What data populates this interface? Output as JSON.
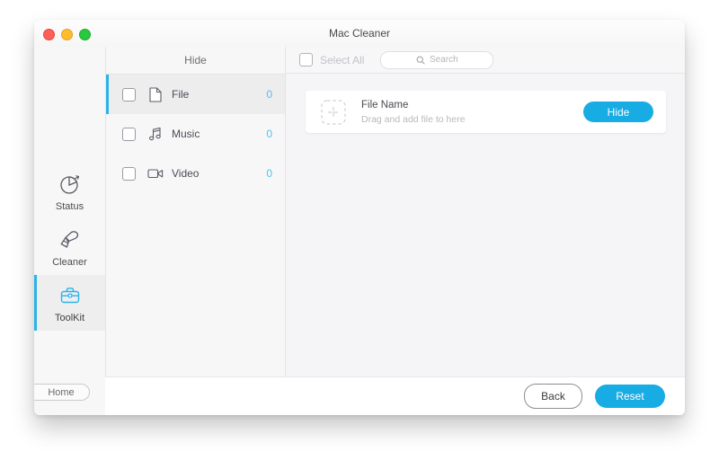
{
  "window": {
    "title": "Mac Cleaner",
    "traffic_lights": [
      {
        "name": "close",
        "color": "#ff5f57"
      },
      {
        "name": "minimize",
        "color": "#ffbd2e"
      },
      {
        "name": "zoom",
        "color": "#28c840"
      }
    ]
  },
  "rail": {
    "items": [
      {
        "label": "Status",
        "icon": "pie-chart-icon",
        "active": false
      },
      {
        "label": "Cleaner",
        "icon": "brush-icon",
        "active": false
      },
      {
        "label": "ToolKit",
        "icon": "toolbox-icon",
        "active": true
      }
    ],
    "home_label": "Home"
  },
  "categories": {
    "header": "Hide",
    "items": [
      {
        "label": "File",
        "count": "0",
        "icon": "file-icon",
        "checked": false,
        "selected": true
      },
      {
        "label": "Music",
        "count": "0",
        "icon": "music-note-icon",
        "checked": false,
        "selected": false
      },
      {
        "label": "Video",
        "count": "0",
        "icon": "video-camera-icon",
        "checked": false,
        "selected": false
      }
    ]
  },
  "toolbar": {
    "select_all_label": "Select All",
    "select_all_checked": false,
    "search_placeholder": "Search"
  },
  "drop_card": {
    "title": "File Name",
    "subtitle": "Drag and add file to here",
    "action_label": "Hide"
  },
  "footer": {
    "back_label": "Back",
    "reset_label": "Reset"
  },
  "colors": {
    "accent": "#18ace4",
    "accent_light": "#4fc0ef",
    "panel_bg": "#f5f5f7",
    "sidebar_bg": "#f7f7f8"
  }
}
